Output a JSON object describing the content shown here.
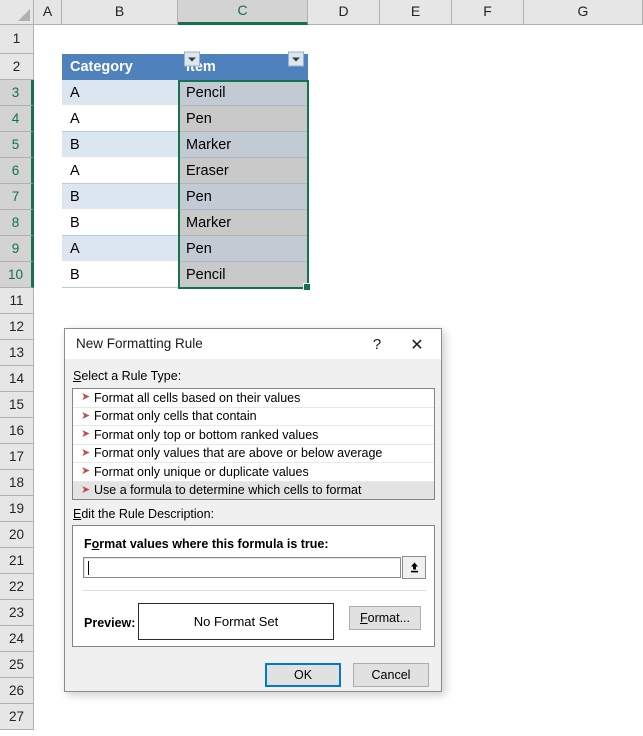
{
  "spreadsheet": {
    "column_headers": [
      "A",
      "B",
      "C",
      "D",
      "E",
      "F",
      "G"
    ],
    "selected_column": "C",
    "row_headers": [
      "1",
      "2",
      "3",
      "4",
      "5",
      "6",
      "7",
      "8",
      "9",
      "10",
      "11",
      "12",
      "13",
      "14",
      "15",
      "16",
      "17",
      "18",
      "19",
      "20",
      "21",
      "22",
      "23",
      "24",
      "25",
      "26",
      "27"
    ],
    "selected_rows": [
      "3",
      "4",
      "5",
      "6",
      "7",
      "8",
      "9",
      "10"
    ],
    "selected_range": "C3:C10",
    "table": {
      "headers": [
        "Category",
        "Item"
      ],
      "rows": [
        {
          "category": "A",
          "item": "Pencil"
        },
        {
          "category": "A",
          "item": "Pen"
        },
        {
          "category": "B",
          "item": "Marker"
        },
        {
          "category": "A",
          "item": "Eraser"
        },
        {
          "category": "B",
          "item": "Pen"
        },
        {
          "category": "B",
          "item": "Marker"
        },
        {
          "category": "A",
          "item": "Pen"
        },
        {
          "category": "B",
          "item": "Pencil"
        }
      ],
      "header_fill": "#4f81bd",
      "band_fill": "#dce6f1",
      "selection_outline": "#157347"
    }
  },
  "dialog": {
    "title": "New Formatting Rule",
    "help_glyph": "?",
    "close_glyph": "✕",
    "rule_type_label": "Select a Rule Type:",
    "rule_types": [
      {
        "label": "Format all cells based on their values",
        "selected": false
      },
      {
        "label": "Format only cells that contain",
        "selected": false
      },
      {
        "label": "Format only top or bottom ranked values",
        "selected": false
      },
      {
        "label": "Format only values that are above or below average",
        "selected": false
      },
      {
        "label": "Format only unique or duplicate values",
        "selected": false
      },
      {
        "label": "Use a formula to determine which cells to format",
        "selected": true
      }
    ],
    "rule_bullet_glyph": "➤",
    "rule_desc_label": "Edit the Rule Description:",
    "formula_label": "Format values where this formula is true:",
    "formula_value": "",
    "formula_placeholder": "",
    "range_picker_glyph": "⬆",
    "preview_label": "Preview:",
    "preview_text": "No Format Set",
    "format_button": "Format...",
    "ok_button": "OK",
    "cancel_button": "Cancel",
    "accent_color": "#0078d7"
  }
}
